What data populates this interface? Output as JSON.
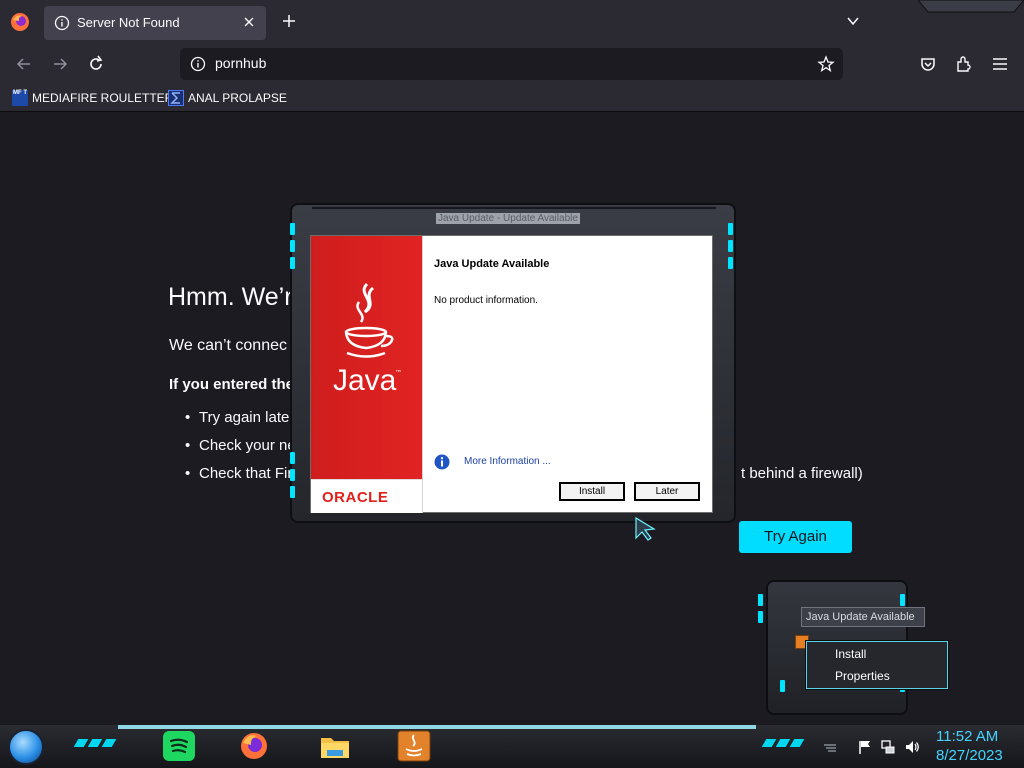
{
  "browser": {
    "tab_title": "Server Not Found",
    "url": "pornhub",
    "bookmarks": [
      {
        "label": "MEDIAFIRE ROULETTER",
        "icon": "mediafire-icon",
        "icon_text": "MF T"
      },
      {
        "label": "ANAL PROLAPSE",
        "icon": "sigma-icon"
      }
    ]
  },
  "page": {
    "title": "Hmm. We’r",
    "line1": "We can’t connec",
    "line2": "If you entered the",
    "bullets": [
      "Try again later",
      "Check your ne",
      "Check that Fir"
    ],
    "bullet_tail": "t behind a firewall)",
    "try_again_label": "Try Again",
    "accent": "#00ddff"
  },
  "java_dialog": {
    "window_caption": "Java Update - Update Available",
    "heading": "Java Update Available",
    "body": "No product information.",
    "more_info": "More Information ...",
    "install_label": "Install",
    "later_label": "Later",
    "brand": "Java",
    "vendor": "ORACLE",
    "brand_color": "#e0201b"
  },
  "tray": {
    "tooltip": "Java Update Available",
    "menu": [
      "Install",
      "Properties"
    ]
  },
  "taskbar": {
    "time": "11:52 AM",
    "date": "8/27/2023",
    "apps": [
      "spotify-icon",
      "firefox-icon",
      "file-explorer-icon",
      "java-icon"
    ],
    "clock_color": "#44d4ff"
  }
}
